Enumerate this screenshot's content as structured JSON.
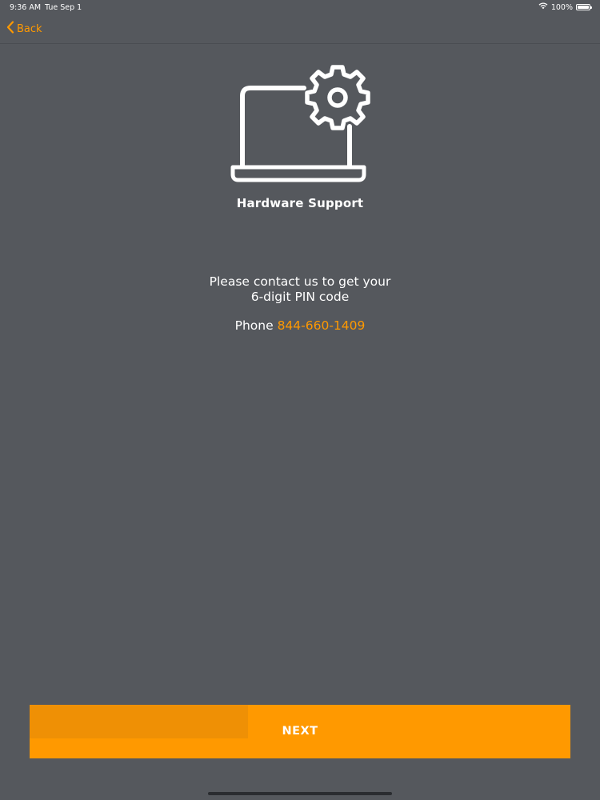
{
  "status_bar": {
    "time": "9:36 AM",
    "date": "Tue Sep 1",
    "battery": "100%",
    "battery_level": 1.0
  },
  "nav": {
    "back_label": "Back"
  },
  "hero": {
    "icon": "laptop-gear-icon",
    "title": "Hardware Support"
  },
  "message": {
    "line1": "Please contact us to get your",
    "line2": "6-digit PIN code",
    "phone_label": "Phone",
    "phone_number": "844-660-1409"
  },
  "actions": {
    "next_label": "NEXT"
  },
  "colors": {
    "background": "#55585d",
    "accent": "#ff9900",
    "text": "#ffffff"
  }
}
